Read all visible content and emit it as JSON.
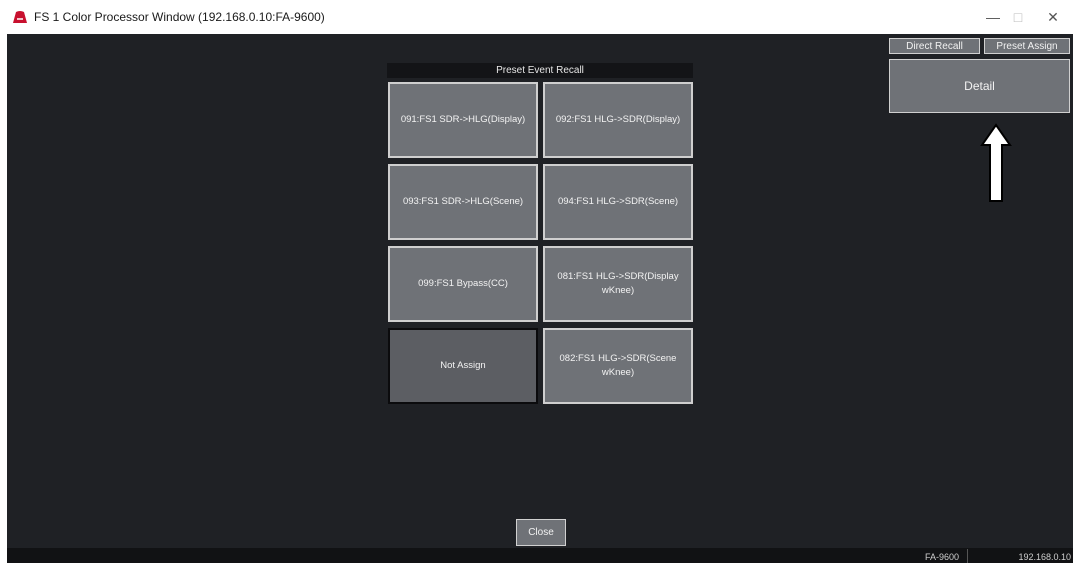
{
  "window": {
    "title": "FS 1 Color Processor Window (192.168.0.10:FA-9600)",
    "controls": {
      "minimize": "—",
      "maximize": "□",
      "close": "✕"
    }
  },
  "toolbar": {
    "direct_recall": "Direct Recall",
    "preset_assign": "Preset Assign",
    "detail": "Detail"
  },
  "panel": {
    "header": "Preset Event Recall",
    "presets": [
      {
        "label": "091:FS1 SDR->HLG(Display)",
        "assigned": true
      },
      {
        "label": "092:FS1 HLG->SDR(Display)",
        "assigned": true
      },
      {
        "label": "093:FS1 SDR->HLG(Scene)",
        "assigned": true
      },
      {
        "label": "094:FS1 HLG->SDR(Scene)",
        "assigned": true
      },
      {
        "label": "099:FS1 Bypass(CC)",
        "assigned": true
      },
      {
        "label": "081:FS1 HLG->SDR(Display wKnee)",
        "assigned": true
      },
      {
        "label": "Not Assign",
        "assigned": false
      },
      {
        "label": "082:FS1 HLG->SDR(Scene wKnee)",
        "assigned": true
      }
    ]
  },
  "footer": {
    "close": "Close"
  },
  "status": {
    "model": "FA-9600",
    "ip": "192.168.0.10"
  },
  "icons": {
    "app_logo": "app-logo-icon",
    "arrow": "arrow-up-icon"
  },
  "colors": {
    "background": "#1f2125",
    "button": "#6f7277",
    "button_border": "#d0d0d0",
    "logo": "#c8102e"
  }
}
